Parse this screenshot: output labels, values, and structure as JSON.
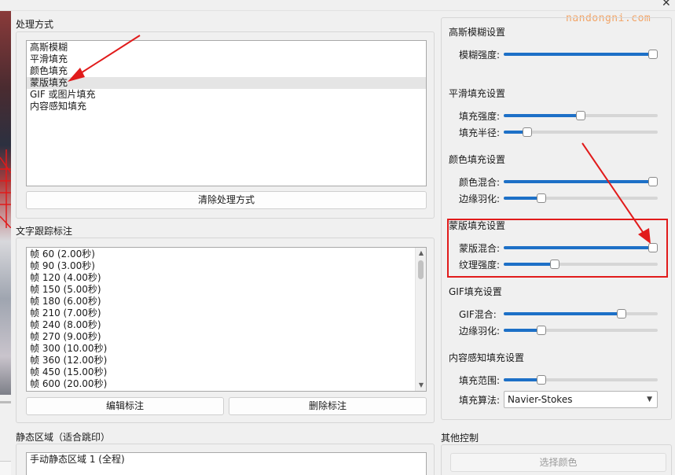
{
  "watermark": "nandongni.com",
  "process": {
    "title": "处理方式",
    "items": [
      "高斯模糊",
      "平滑填充",
      "颜色填充",
      "蒙版填充",
      "GIF 或图片填充",
      "内容感知填充"
    ],
    "selected_index": 3,
    "clear_button": "清除处理方式"
  },
  "tracking": {
    "title": "文字跟踪标注",
    "items": [
      "帧 60 (2.00秒)",
      "帧 90 (3.00秒)",
      "帧 120 (4.00秒)",
      "帧 150 (5.00秒)",
      "帧 180 (6.00秒)",
      "帧 210 (7.00秒)",
      "帧 240 (8.00秒)",
      "帧 270 (9.00秒)",
      "帧 300 (10.00秒)",
      "帧 360 (12.00秒)",
      "帧 450 (15.00秒)",
      "帧 600 (20.00秒)"
    ],
    "edit_button": "编辑标注",
    "delete_button": "删除标注"
  },
  "static_region": {
    "title": "静态区域（适合跳印）",
    "items": [
      "手动静态区域 1 (全程)"
    ]
  },
  "settings": {
    "gaussian": {
      "title": "高斯模糊设置",
      "strength_label": "模糊强度:",
      "strength": 1.0
    },
    "smooth": {
      "title": "平滑填充设置",
      "strength_label": "填充强度:",
      "strength": 0.5,
      "radius_label": "填充半径:",
      "radius": 0.13
    },
    "color": {
      "title": "颜色填充设置",
      "mix_label": "颜色混合:",
      "mix": 1.0,
      "feather_label": "边缘羽化:",
      "feather": 0.23
    },
    "mask": {
      "title": "蒙版填充设置",
      "mix_label": "蒙版混合:",
      "mix": 1.0,
      "texture_label": "纹理强度:",
      "texture": 0.32
    },
    "gif": {
      "title": "GIF填充设置",
      "mix_label": "GIF混合:",
      "mix": 0.78,
      "feather_label": "边缘羽化:",
      "feather": 0.23
    },
    "content_aware": {
      "title": "内容感知填充设置",
      "range_label": "填充范围:",
      "range": 0.23,
      "algorithm_label": "填充算法:",
      "algorithm": "Navier-Stokes"
    }
  },
  "other": {
    "title": "其他控制",
    "select_color_button": "选择颜色"
  },
  "colors": {
    "accent": "#1d70c7",
    "annotation": "#e11b1b"
  }
}
